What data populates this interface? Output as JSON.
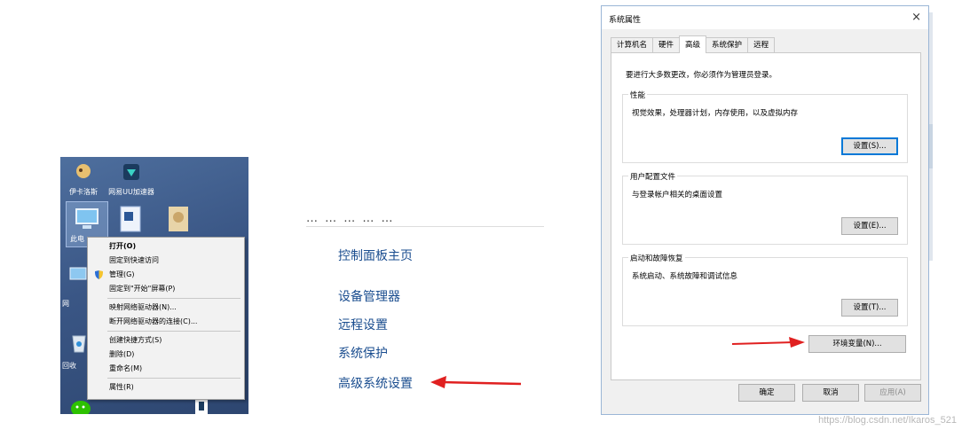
{
  "desktop": {
    "icons": [
      {
        "label": "伊卡洛斯"
      },
      {
        "label": "网易UU加速器"
      }
    ],
    "pc_label": "此电",
    "side_labels": [
      "网",
      "回收"
    ]
  },
  "context_menu": {
    "items": [
      {
        "label": "打开(O)",
        "bold": true
      },
      {
        "label": "固定到快速访问"
      },
      {
        "label": "管理(G)",
        "icon": "shield-icon"
      },
      {
        "label": "固定到\"开始\"屏幕(P)"
      },
      {
        "sep": true
      },
      {
        "label": "映射网络驱动器(N)..."
      },
      {
        "label": "断开网络驱动器的连接(C)..."
      },
      {
        "sep": true
      },
      {
        "label": "创建快捷方式(S)"
      },
      {
        "label": "删除(D)"
      },
      {
        "label": "重命名(M)"
      },
      {
        "sep": true
      },
      {
        "label": "属性(R)"
      }
    ]
  },
  "control_panel": {
    "cut_text": "…  …  …  …  …",
    "home": "控制面板主页",
    "links": [
      "设备管理器",
      "远程设置",
      "系统保护",
      "高级系统设置"
    ],
    "arrow_color": "#e02020"
  },
  "dialog": {
    "title": "系统属性",
    "close_icon": "×",
    "tabs": [
      "计算机名",
      "硬件",
      "高级",
      "系统保护",
      "远程"
    ],
    "active_tab": 2,
    "note": "要进行大多数更改，你必须作为管理员登录。",
    "groups": [
      {
        "title": "性能",
        "desc": "视觉效果，处理器计划，内存使用，以及虚拟内存",
        "button": "设置(S)..."
      },
      {
        "title": "用户配置文件",
        "desc": "与登录帐户相关的桌面设置",
        "button": "设置(E)..."
      },
      {
        "title": "启动和故障恢复",
        "desc": "系统启动、系统故障和调试信息",
        "button": "设置(T)..."
      }
    ],
    "env_button": "环境变量(N)...",
    "ok": "确定",
    "cancel": "取消",
    "apply": "应用(A)"
  },
  "watermark": "https://blog.csdn.net/Ikaros_521"
}
